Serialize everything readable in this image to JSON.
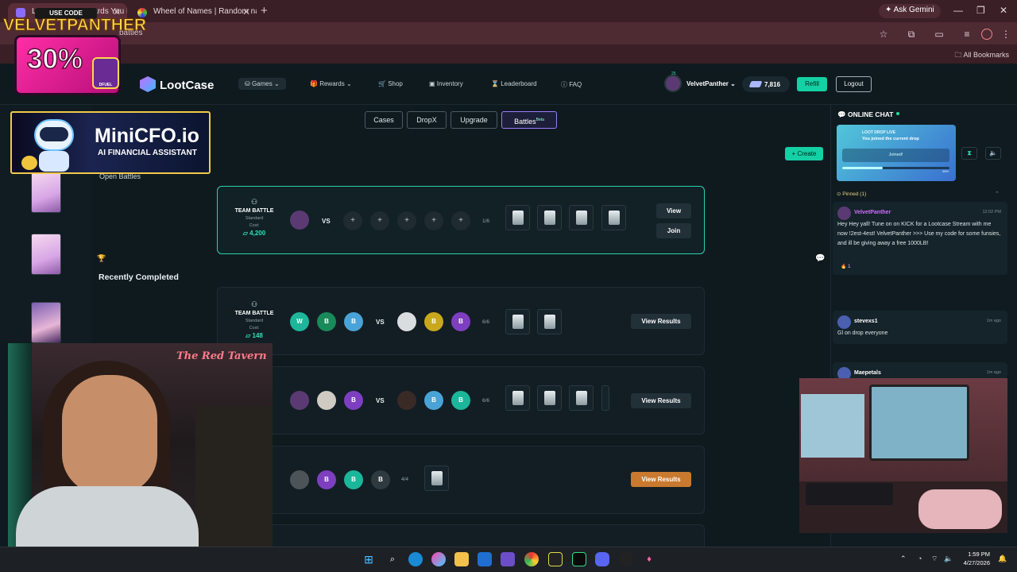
{
  "browser": {
    "tabs": [
      {
        "title": "LootCase.GG - Cards You Love",
        "active": true
      },
      {
        "title": "Wheel of Names | Random nam",
        "active": false
      }
    ],
    "new_tab": "+",
    "ask_gemini": "Ask Gemini",
    "url": "battles",
    "all_bookmarks": "All Bookmarks"
  },
  "site": {
    "logo": "LootCase",
    "nav": [
      {
        "label": "Games",
        "selected": true
      },
      {
        "label": "Rewards",
        "selected": false
      },
      {
        "label": "Shop",
        "selected": false
      },
      {
        "label": "Inventory",
        "selected": false
      },
      {
        "label": "Leaderboard",
        "selected": false
      },
      {
        "label": "FAQ",
        "selected": false
      }
    ],
    "user": {
      "level": "25",
      "name": "VelvetPanther"
    },
    "balance": "7,816",
    "refill": "Refill",
    "logout": "Logout"
  },
  "game_tabs": [
    {
      "label": "Cases"
    },
    {
      "label": "DropX"
    },
    {
      "label": "Upgrade"
    },
    {
      "label": "Battles",
      "badge": "Beta",
      "selected": true
    }
  ],
  "create": "+ Create",
  "sections": {
    "open": "Open Battles",
    "recent": "Recently Completed"
  },
  "battles": [
    {
      "mode": "TEAM BATTLE",
      "type": "Standard",
      "cost_label": "Cost:",
      "cost": "4,200",
      "count": "1/6",
      "buttons": [
        "View",
        "Join"
      ]
    },
    {
      "mode": "TEAM BATTLE",
      "type": "Standard",
      "cost_label": "Cost:",
      "cost": "148",
      "count": "6/6",
      "players_left": [
        "W",
        "B",
        "B"
      ],
      "players_right": [
        "",
        "B",
        "B"
      ],
      "button": "View Results"
    },
    {
      "count": "6/6",
      "players_left": [
        "",
        "",
        "B"
      ],
      "players_right": [
        "",
        "B",
        "B"
      ],
      "button": "View Results"
    },
    {
      "count": "4/4",
      "players": [
        "",
        "B",
        "B",
        "B"
      ],
      "button": "View Results"
    }
  ],
  "vs": "VS",
  "chat": {
    "title": "ONLINE CHAT",
    "drop_label": "LOOT DROP LIVE",
    "drop_message": "You joined the current drop",
    "joined": "Joined!",
    "drop_progress_pct": 38,
    "drop_pct_label": "38%",
    "pinned": "Pinned (1)",
    "messages": [
      {
        "level": "25",
        "name": "VelvetPanther",
        "time": "12:02 PM",
        "text": "Hey Hey yall! Tune on on KICK for a Lootcase Stream with me now !2est-4est! VelvetPanther >>> Use my code for some funsies, and ill be giving away a free 1000LB!",
        "reactions": "1"
      },
      {
        "level": "25",
        "name": "stevexs1",
        "time": "1m ago",
        "text": "Gl on drop everyone"
      },
      {
        "level": "18",
        "name": "Maepetals",
        "time": "1m ago",
        "text": ""
      }
    ]
  },
  "overlays": {
    "promo_use": "USE CODE",
    "promo_code": "VELVETPANTHER",
    "promo_pct": "30%",
    "promo_brand": "DFUEL",
    "minicfo_title": "MiniCFO.io",
    "minicfo_sub": "AI FINANCIAL ASSISTANT",
    "neon_sign": "The Red Tavern"
  },
  "taskbar": {
    "time": "1:59 PM",
    "date": "4/27/2026"
  }
}
